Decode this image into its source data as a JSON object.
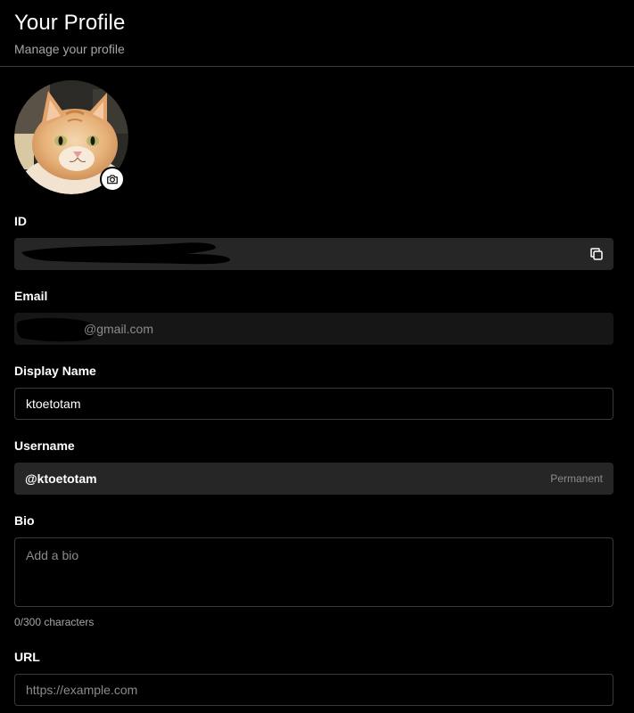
{
  "header": {
    "title": "Your Profile",
    "subtitle": "Manage your profile"
  },
  "avatar": {
    "alt": "cat",
    "camera_icon": "camera-icon"
  },
  "id_field": {
    "label": "ID",
    "copy_icon": "copy-icon"
  },
  "email_field": {
    "label": "Email",
    "visible_suffix": "@gmail.com"
  },
  "display_name_field": {
    "label": "Display Name",
    "value": "ktoetotam"
  },
  "username_field": {
    "label": "Username",
    "value": "@ktoetotam",
    "badge": "Permanent"
  },
  "bio_field": {
    "label": "Bio",
    "placeholder": "Add a bio",
    "char_count": "0/300 characters"
  },
  "url_field": {
    "label": "URL",
    "placeholder": "https://example.com"
  },
  "colors": {
    "background": "#000000",
    "readonly_field": "#262626",
    "border": "#3a3a3a",
    "muted_text": "#8c8c8c"
  }
}
